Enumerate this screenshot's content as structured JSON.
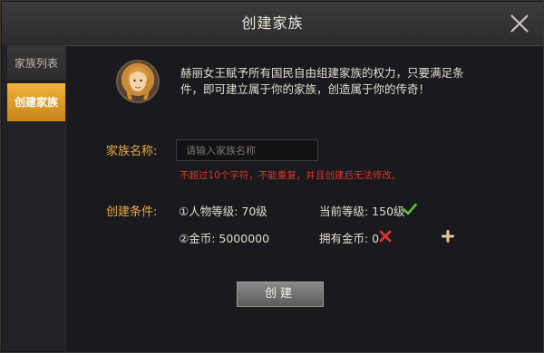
{
  "window": {
    "title": "创建家族",
    "close_icon": "close-icon"
  },
  "sidebar": {
    "tabs": [
      {
        "label": "家族列表",
        "active": false
      },
      {
        "label": "创建家族",
        "active": true
      }
    ]
  },
  "main": {
    "avatar_icon": "queen-portrait",
    "description": "赫丽女王赋予所有国民自由组建家族的权力，只要满足条件，即可建立属于你的家族，创造属于你的传奇！",
    "name_label": "家族名称:",
    "name_input": {
      "value": "",
      "placeholder": "请输入家族名称"
    },
    "name_warning": "不超过10个字符，不能重复，并且创建后无法修改。",
    "conditions_label": "创建条件:",
    "condition_level": "①人物等级: 70级",
    "current_level": "当前等级: 150级",
    "condition_gold": "②金币: 5000000",
    "owned_gold": "拥有金币: 0",
    "create_button": "创建"
  },
  "colors": {
    "accent": "#e8a945",
    "warning": "#d8352c",
    "ok": "#5fbf3a",
    "active_tab": "#f0b43a"
  }
}
